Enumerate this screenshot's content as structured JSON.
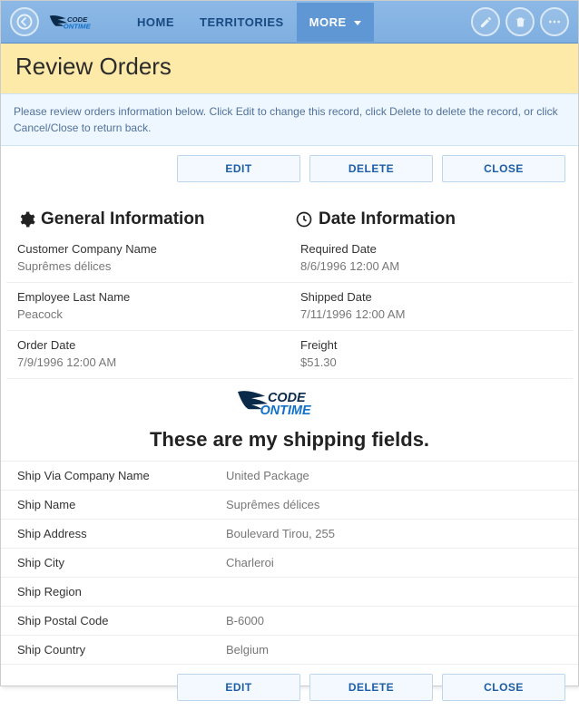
{
  "nav": {
    "home": "HOME",
    "territories": "TERRITORIES",
    "more": "MORE"
  },
  "page_title": "Review Orders",
  "help_text": "Please review orders information below. Click Edit to change this record, click Delete to delete the record, or click Cancel/Close to return back.",
  "buttons": {
    "edit": "EDIT",
    "delete": "DELETE",
    "close": "CLOSE"
  },
  "sections": {
    "general_title": "General Information",
    "date_title": "Date Information"
  },
  "general": {
    "company_label": "Customer Company Name",
    "company_value": "Suprêmes délices",
    "employee_label": "Employee Last Name",
    "employee_value": "Peacock",
    "orderdate_label": "Order Date",
    "orderdate_value": "7/9/1996 12:00 AM"
  },
  "dates": {
    "required_label": "Required Date",
    "required_value": "8/6/1996 12:00 AM",
    "shipped_label": "Shipped Date",
    "shipped_value": "7/11/1996 12:00 AM",
    "freight_label": "Freight",
    "freight_value": "$51.30"
  },
  "shipping_title": "These are my shipping fields.",
  "shipping": {
    "via_label": "Ship Via Company Name",
    "via_value": "United Package",
    "name_label": "Ship Name",
    "name_value": "Suprêmes délices",
    "addr_label": "Ship Address",
    "addr_value": "Boulevard Tirou, 255",
    "city_label": "Ship City",
    "city_value": "Charleroi",
    "region_label": "Ship Region",
    "region_value": "",
    "postal_label": "Ship Postal Code",
    "postal_value": "B-6000",
    "country_label": "Ship Country",
    "country_value": "Belgium"
  }
}
